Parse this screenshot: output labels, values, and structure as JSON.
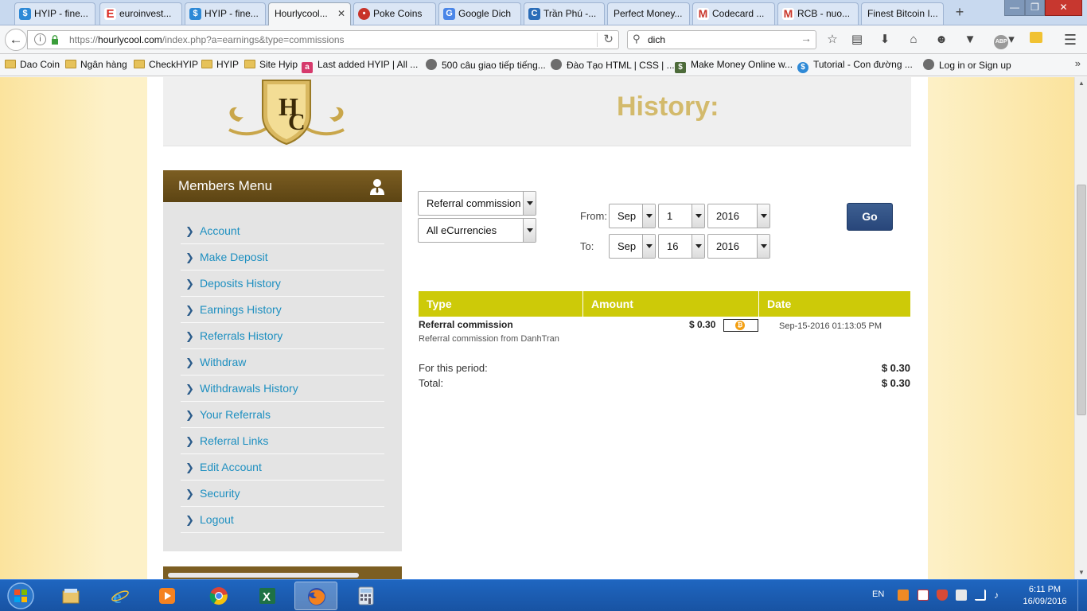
{
  "browser": {
    "tabs": [
      {
        "label": "HYIP - fine...",
        "icon": "hyip-icon",
        "color": "#2e89d6"
      },
      {
        "label": "euroinvest...",
        "icon": "euroinvest-icon",
        "color": "#d9241c"
      },
      {
        "label": "HYIP - fine...",
        "icon": "hyip-icon",
        "color": "#2e89d6"
      },
      {
        "label": "Hourlycool...",
        "icon": "hourlycool-icon",
        "color": "#c9a64a"
      },
      {
        "label": "Poke Coins",
        "icon": "pokecoins-icon",
        "color": "#c8342a"
      },
      {
        "label": "Google Dich",
        "icon": "google-translate-icon",
        "color": "#4a86e8"
      },
      {
        "label": "Trần Phú -...",
        "icon": "c-icon",
        "color": "#2b6db8"
      },
      {
        "label": "Perfect Money...",
        "icon": "perfectmoney-icon",
        "color": "#cccccc"
      },
      {
        "label": "Codecard ...",
        "icon": "gmail-icon",
        "color": "#c9372c"
      },
      {
        "label": "RCB - nuo...",
        "icon": "gmail-icon",
        "color": "#c9372c"
      },
      {
        "label": "Finest Bitcoin I...",
        "icon": "blank-icon",
        "color": "#dddddd"
      }
    ],
    "new_tab": "+",
    "url_prefix": "https://",
    "url_host": "hourlycool.com",
    "url_path": "/index.php?a=earnings&type=commissions",
    "search_value": "dich",
    "bookmarks": [
      {
        "label": "Dao Coin",
        "icon": "folder-icon"
      },
      {
        "label": "Ngân hàng",
        "icon": "folder-icon"
      },
      {
        "label": "CheckHYIP",
        "icon": "folder-icon"
      },
      {
        "label": "HYIP",
        "icon": "folder-icon"
      },
      {
        "label": "Site Hyip",
        "icon": "folder-icon"
      },
      {
        "label": "Last added HYIP | All ...",
        "icon": "a-icon"
      },
      {
        "label": "500 câu giao tiếp tiếng...",
        "icon": "globe-icon"
      },
      {
        "label": "Đào Tạo HTML | CSS | ...",
        "icon": "globe-icon"
      },
      {
        "label": "Make Money Online w...",
        "icon": "money-icon"
      },
      {
        "label": "Tutorial - Con đường ...",
        "icon": "dollar-icon"
      },
      {
        "label": "Log in or Sign up",
        "icon": "globe-icon"
      }
    ],
    "bookmarks_more": "»"
  },
  "page": {
    "title": "History:",
    "logo_letters": "HC",
    "members_menu": {
      "title": "Members Menu",
      "items": [
        "Account",
        "Make Deposit",
        "Deposits History",
        "Earnings History",
        "Referrals History",
        "Withdraw",
        "Withdrawals History",
        "Your Referrals",
        "Referral Links",
        "Edit Account",
        "Security",
        "Logout"
      ]
    },
    "filters": {
      "type_selected": "Referral commission",
      "currency_selected": "All eCurrencies",
      "from_label": "From:",
      "to_label": "To:",
      "from": {
        "month": "Sep",
        "day": "1",
        "year": "2016"
      },
      "to": {
        "month": "Sep",
        "day": "16",
        "year": "2016"
      },
      "go_label": "Go"
    },
    "table": {
      "headers": [
        "Type",
        "Amount",
        "Date"
      ],
      "header_color": "#cdca08",
      "rows": [
        {
          "type": "Referral commission",
          "description": "Referral commission from DanhTran",
          "amount": "$ 0.30",
          "currency_icon": "bitcoin-icon",
          "date": "Sep-15-2016 01:13:05 PM"
        }
      ],
      "period_label": "For this period:",
      "period_value": "$ 0.30",
      "total_label": "Total:",
      "total_value": "$ 0.30"
    }
  },
  "taskbar": {
    "apps": [
      "windows-explorer",
      "internet-explorer",
      "media-player",
      "chrome",
      "excel",
      "firefox",
      "calculator"
    ],
    "active_app": "firefox",
    "language": "EN",
    "time": "6:11 PM",
    "date": "16/09/2016"
  }
}
